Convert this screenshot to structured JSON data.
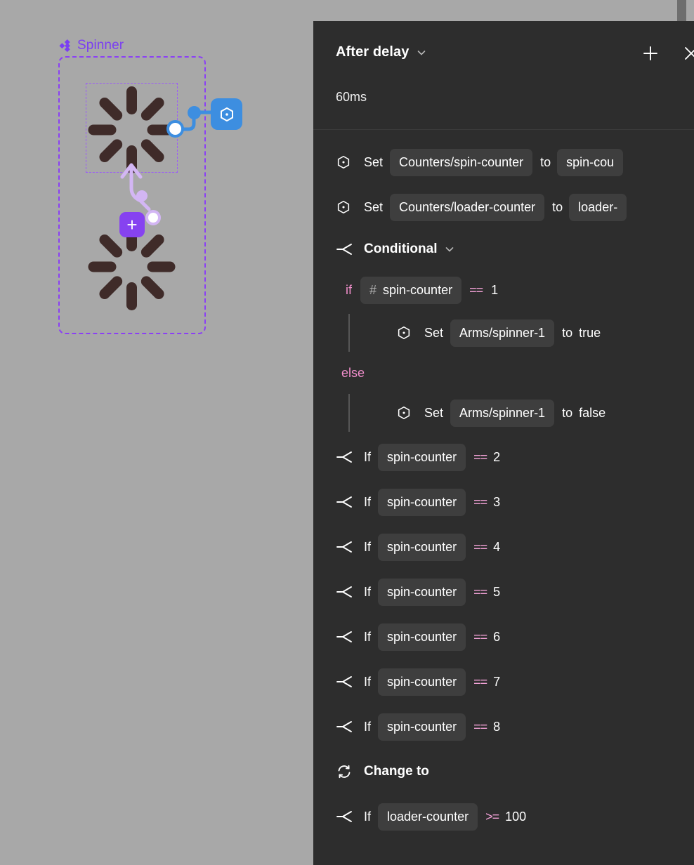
{
  "canvas": {
    "component_label": "Spinner",
    "component_icon": "diamond-cluster-icon",
    "node_badge_icon": "hexagon-variable-icon",
    "add_button_label": "+",
    "colors": {
      "background": "#a8a8a8",
      "selection": "#8b3ff5",
      "component_label": "#7b3ff2",
      "spinner_arm": "#3f2b29",
      "connector_blue": "#3d8ee0",
      "connector_purple": "#d3b6f4",
      "plus_badge": "#8642f0"
    },
    "spinner_arm_count": 8
  },
  "panel": {
    "title": "After delay",
    "title_chevron_icon": "chevron-down-icon",
    "subtitle": "60ms",
    "add_icon": "plus-icon",
    "close_icon": "close-icon",
    "colors": {
      "background": "#2d2d2d",
      "chip": "#3e3e3e",
      "keyword_pink": "#f08ecb",
      "text": "#ffffff"
    },
    "rows": [
      {
        "kind": "set",
        "icon": "hexagon-variable-icon",
        "label": "Set",
        "target": "Counters/spin-counter",
        "to_label": "to",
        "value": "spin-cou"
      },
      {
        "kind": "set",
        "icon": "hexagon-variable-icon",
        "label": "Set",
        "target": "Counters/loader-counter",
        "to_label": "to",
        "value": "loader-"
      }
    ],
    "conditional": {
      "icon": "branch-icon",
      "title": "Conditional",
      "chevron_icon": "chevron-down-icon",
      "if_keyword": "if",
      "if_chip_icon": "hash-icon",
      "if_chip": "spin-counter",
      "if_operator": "==",
      "if_value": "1",
      "then": {
        "icon": "hexagon-variable-icon",
        "label": "Set",
        "target": "Arms/spinner-1",
        "to_label": "to",
        "value": "true"
      },
      "else_keyword": "else",
      "else": {
        "icon": "hexagon-variable-icon",
        "label": "Set",
        "target": "Arms/spinner-1",
        "to_label": "to",
        "value": "false"
      }
    },
    "collapsed_ifs": [
      {
        "icon": "branch-icon",
        "label": "If",
        "chip": "spin-counter",
        "operator": "==",
        "value": "2"
      },
      {
        "icon": "branch-icon",
        "label": "If",
        "chip": "spin-counter",
        "operator": "==",
        "value": "3"
      },
      {
        "icon": "branch-icon",
        "label": "If",
        "chip": "spin-counter",
        "operator": "==",
        "value": "4"
      },
      {
        "icon": "branch-icon",
        "label": "If",
        "chip": "spin-counter",
        "operator": "==",
        "value": "5"
      },
      {
        "icon": "branch-icon",
        "label": "If",
        "chip": "spin-counter",
        "operator": "==",
        "value": "6"
      },
      {
        "icon": "branch-icon",
        "label": "If",
        "chip": "spin-counter",
        "operator": "==",
        "value": "7"
      },
      {
        "icon": "branch-icon",
        "label": "If",
        "chip": "spin-counter",
        "operator": "==",
        "value": "8"
      }
    ],
    "change_to": {
      "icon": "swap-arrows-icon",
      "label": "Change to"
    },
    "last_if": {
      "icon": "branch-icon",
      "label": "If",
      "chip": "loader-counter",
      "operator": ">=",
      "value": "100"
    }
  }
}
